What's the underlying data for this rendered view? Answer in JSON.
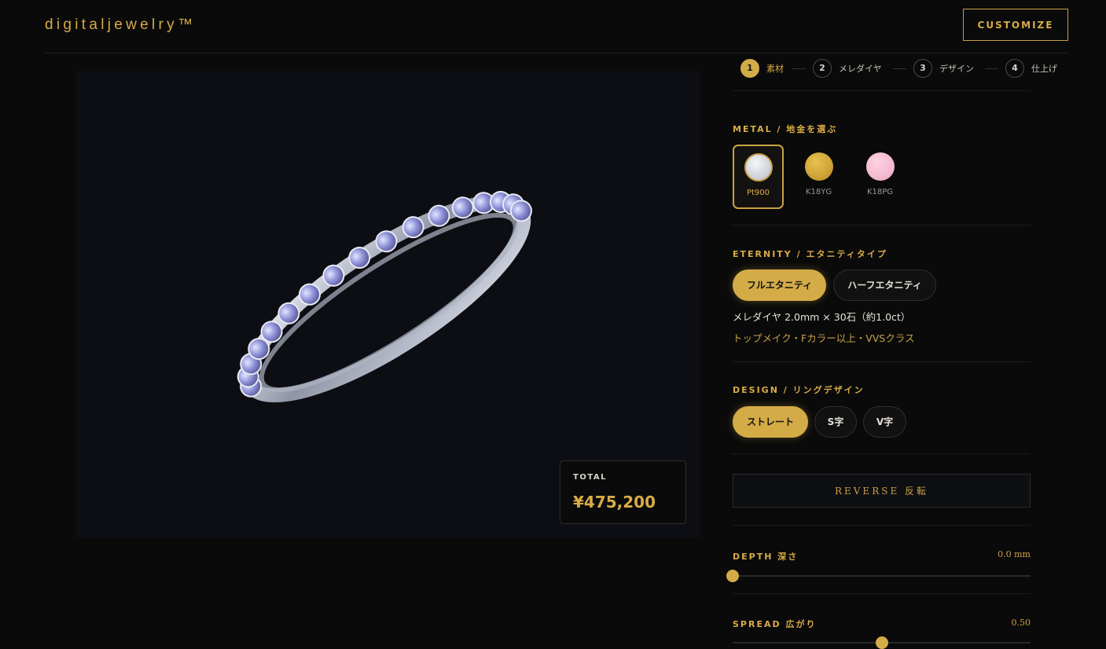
{
  "header": {
    "brand": "digitaljewelry™",
    "customize_label": "CUSTOMIZE"
  },
  "steps": [
    {
      "num": "1",
      "label": "素材",
      "active": true
    },
    {
      "num": "2",
      "label": "メレダイヤ",
      "active": false
    },
    {
      "num": "3",
      "label": "デザイン",
      "active": false
    },
    {
      "num": "4",
      "label": "仕上げ",
      "active": false
    }
  ],
  "metal": {
    "title": "METAL / 地金を選ぶ",
    "options": [
      {
        "label": "Pt900",
        "color": "#cfd2da",
        "selected": true
      },
      {
        "label": "K18YG",
        "color": "#d4a93a",
        "selected": false
      },
      {
        "label": "K18PG",
        "color": "#f4b9cf",
        "selected": false
      }
    ]
  },
  "eternity": {
    "title": "ETERNITY / エタニティタイプ",
    "options": [
      {
        "label": "フルエタニティ",
        "selected": true
      },
      {
        "label": "ハーフエタニティ",
        "selected": false
      }
    ],
    "spec": "メレダイヤ 2.0mm × 30石（約1.0ct）",
    "quality": "トップメイク・Fカラー以上・VVSクラス"
  },
  "design": {
    "title": "DESIGN / リングデザイン",
    "options": [
      {
        "label": "ストレート",
        "selected": true
      },
      {
        "label": "S字",
        "selected": false
      },
      {
        "label": "V字",
        "selected": false
      }
    ]
  },
  "reverse_label": "REVERSE 反転",
  "depth": {
    "label": "DEPTH 深さ",
    "value_text": "0.0 mm",
    "level": 0
  },
  "spread": {
    "label": "SPREAD 広がり",
    "value_text": "0.50",
    "level": 0.5
  },
  "total": {
    "label": "TOTAL",
    "price": "¥475,200"
  },
  "colors": {
    "accent": "#d3ab47",
    "background": "#0a0a0a",
    "viewer_bg": "#0d0e13"
  }
}
